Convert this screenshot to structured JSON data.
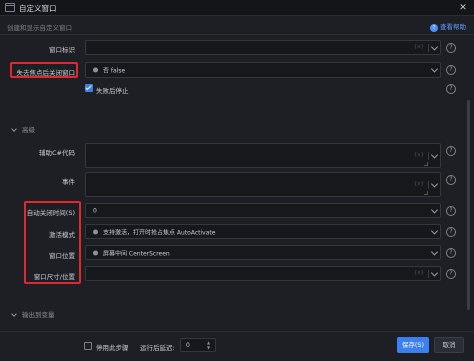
{
  "window": {
    "title": "自定义窗口",
    "close_glyph": "✕"
  },
  "header": {
    "description": "创建和显示自定义窗口",
    "help_label": "查看帮助",
    "help_glyph": "?"
  },
  "form": {
    "window_id": {
      "label": "窗口标识",
      "value": "",
      "fx": "{x}"
    },
    "close_on_blur": {
      "label": "失去焦点后关闭窗口",
      "value": "否  false"
    },
    "stop_on_fail": {
      "label": "失败后停止",
      "checked": true
    },
    "advanced_section": "高级",
    "aux_code": {
      "label": "辅助C#代码",
      "value": "",
      "fx": "{x}"
    },
    "events": {
      "label": "事件",
      "value": "",
      "fx": "{x}"
    },
    "auto_close_time": {
      "label": "自动关闭时间(S)",
      "value": "0"
    },
    "activation_mode": {
      "label": "激活模式",
      "value": "支持激活，打开时抢占焦点  AutoActivate"
    },
    "window_position": {
      "label": "窗口位置",
      "value": "屏幕中间  CenterScreen"
    },
    "window_size_position": {
      "label": "窗口尺寸/位置",
      "value": "",
      "fx": "{x}"
    },
    "output_section": "输出到变量"
  },
  "footer": {
    "disable_step_label": "停用此步骤",
    "disable_step_checked": false,
    "run_delay_label": "运行后延迟:",
    "run_delay_value": "0",
    "save_label": "保存(S)",
    "cancel_label": "取消"
  },
  "colors": {
    "accent": "#3b7ff0",
    "highlight_box": "#e0282e",
    "background": "#1d1f24"
  },
  "icons": {
    "help": "question-circle-icon",
    "dropdown": "chevron-down-icon",
    "window": "window-icon"
  }
}
